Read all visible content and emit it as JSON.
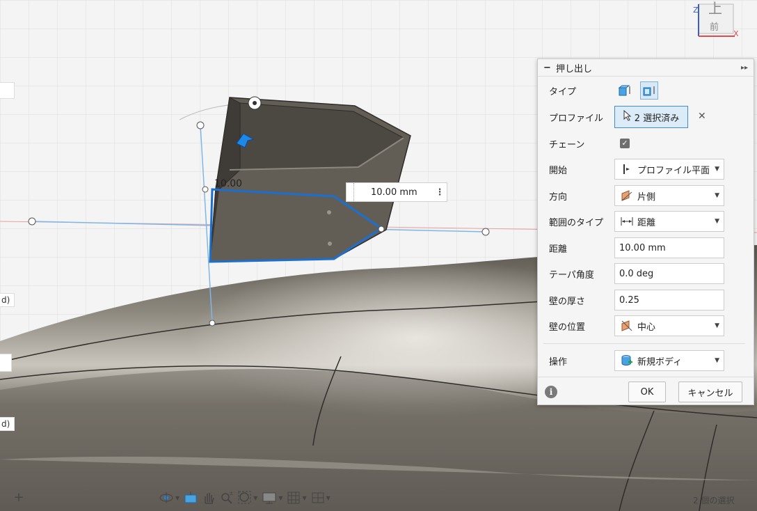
{
  "viewport": {
    "dimension_label": "10.00",
    "dimension_input": "10.00 mm",
    "side_tags": [
      "d)",
      "",
      "d)"
    ]
  },
  "viewcube": {
    "top_face": "上",
    "front_face": "前",
    "axis_x": "X",
    "axis_z": "Z"
  },
  "dialog": {
    "title": "押し出し",
    "rows": {
      "type": {
        "label": "タイプ"
      },
      "profile": {
        "label": "プロファイル",
        "value": "2 選択済み"
      },
      "chain": {
        "label": "チェーン",
        "checked": true
      },
      "start": {
        "label": "開始",
        "value": "プロファイル平面"
      },
      "direction": {
        "label": "方向",
        "value": "片側"
      },
      "extent_type": {
        "label": "範囲のタイプ",
        "value": "距離"
      },
      "distance": {
        "label": "距離",
        "value": "10.00 mm"
      },
      "taper": {
        "label": "テーパ角度",
        "value": "0.0 deg"
      },
      "wall_thickness": {
        "label": "壁の厚さ",
        "value": "0.25"
      },
      "wall_position": {
        "label": "壁の位置",
        "value": "中心"
      },
      "operation": {
        "label": "操作",
        "value": "新規ボディ"
      }
    },
    "ok": "OK",
    "cancel": "キャンセル"
  },
  "status": {
    "selection": "2 個の選択"
  },
  "colors": {
    "accent": "#3e8fd0",
    "model": "#6b665d"
  }
}
